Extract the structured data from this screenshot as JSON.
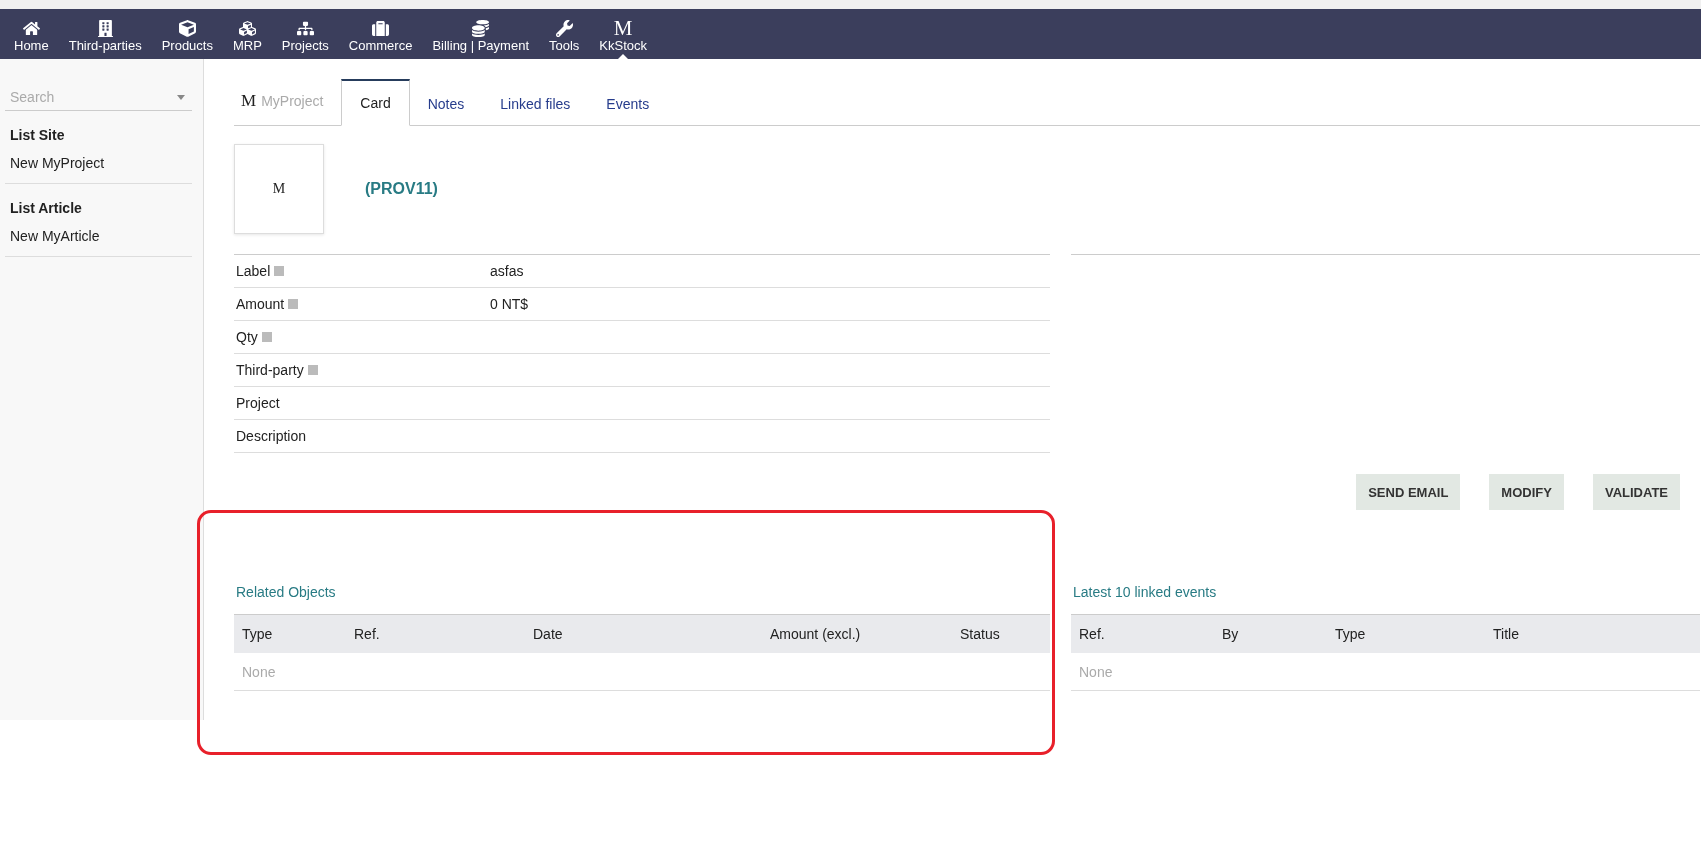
{
  "top_menu": [
    {
      "label": "Home",
      "kind": "icon",
      "selected": false
    },
    {
      "label": "Third-parties",
      "kind": "icon",
      "selected": false
    },
    {
      "label": "Products",
      "kind": "icon",
      "selected": false
    },
    {
      "label": "MRP",
      "kind": "icon",
      "selected": false
    },
    {
      "label": "Projects",
      "kind": "icon",
      "selected": false
    },
    {
      "label": "Commerce",
      "kind": "icon",
      "selected": false
    },
    {
      "label": "Billing | Payment",
      "kind": "icon",
      "selected": false
    },
    {
      "label": "Tools",
      "kind": "icon",
      "selected": false
    },
    {
      "label": "KkStock",
      "kind": "letter",
      "glyph": "M",
      "selected": true
    }
  ],
  "sidebar": {
    "search": {
      "placeholder": "Search"
    },
    "sections": [
      {
        "title": "List Site",
        "items": [
          "New MyProject"
        ]
      },
      {
        "title": "List Article",
        "items": [
          "New MyArticle"
        ]
      }
    ]
  },
  "tabs": {
    "module": {
      "glyph": "M",
      "label": "MyProject"
    },
    "items": [
      {
        "label": "Card",
        "selected": true
      },
      {
        "label": "Notes",
        "selected": false
      },
      {
        "label": "Linked files",
        "selected": false
      },
      {
        "label": "Events",
        "selected": false
      }
    ]
  },
  "header": {
    "logo_glyph": "M",
    "ref": "(PROV11)"
  },
  "fields": [
    {
      "label": "Label",
      "help": true,
      "value": "asfas"
    },
    {
      "label": "Amount",
      "help": true,
      "value": "0 NT$"
    },
    {
      "label": "Qty",
      "help": true
    },
    {
      "label": "Third-party",
      "help": true
    },
    {
      "label": "Project",
      "help": false
    },
    {
      "label": "Description",
      "help": false
    }
  ],
  "actions": [
    "SEND EMAIL",
    "MODIFY",
    "VALIDATE"
  ],
  "related_objects": {
    "title": "Related Objects",
    "columns": [
      "Type",
      "Ref.",
      "Date",
      "Amount (excl.)",
      "Status"
    ],
    "empty": "None",
    "highlighted": true
  },
  "linked_events": {
    "title": "Latest 10 linked events",
    "columns": [
      "Ref.",
      "By",
      "Type",
      "Title"
    ],
    "empty": "None"
  }
}
